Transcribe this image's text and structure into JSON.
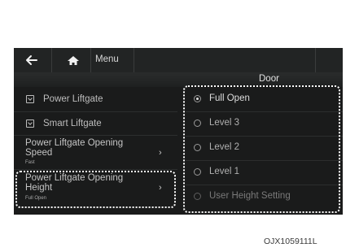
{
  "topbar": {
    "back_icon": "back-arrow-icon",
    "home_icon": "home-icon",
    "menu_label": "Menu"
  },
  "header": {
    "title": "Door"
  },
  "left_menu": {
    "power_liftgate": "Power Liftgate",
    "smart_liftgate": "Smart Liftgate",
    "opening_speed": {
      "line1": "Power Liftgate Opening",
      "line2": "Speed",
      "value": "Fast"
    },
    "opening_height": {
      "line1": "Power Liftgate Opening",
      "line2": "Height",
      "value": "Full Open"
    }
  },
  "options": {
    "full_open": "Full Open",
    "level_3": "Level 3",
    "level_2": "Level 2",
    "level_1": "Level 1",
    "user_height": "User Height Setting"
  },
  "caption": "OJX1059111L"
}
